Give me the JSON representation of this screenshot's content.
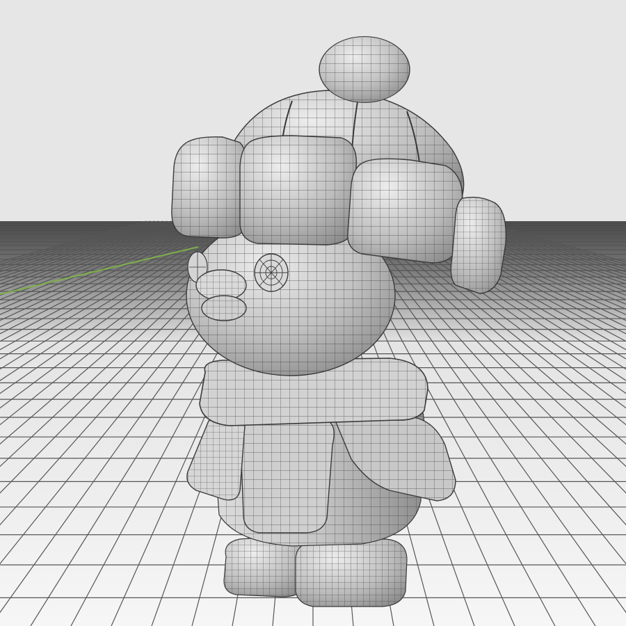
{
  "viewport": {
    "colors": {
      "background_top": "#e6e6e6",
      "ground_far": "#4b4b4b",
      "ground_near": "#f4f4f4",
      "grid_line": "#5a5a5a",
      "axis_line": "#7fb04a",
      "mesh_fill": "#c4c4c4",
      "mesh_shadow": "#8f8f8f",
      "mesh_highlight": "#e8e8e8",
      "wireframe": "#3a3a3a"
    },
    "model": {
      "name_icon": "character-mesh-wireframe"
    }
  }
}
